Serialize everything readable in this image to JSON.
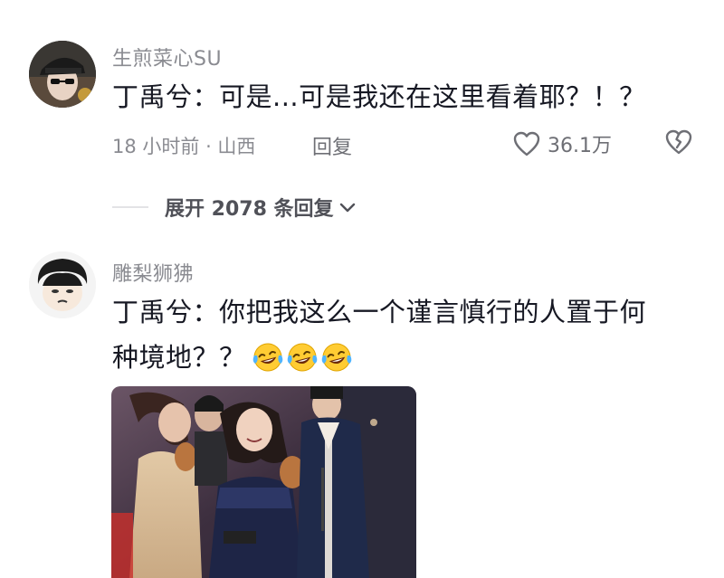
{
  "comment1": {
    "username": "生煎菜心SU",
    "text": "丁禹兮：可是...可是我还在这里看着耶？！？",
    "meta": "18 小时前 · 山西",
    "reply_label": "回复",
    "likes": "36.1万"
  },
  "expand": {
    "label": "展开 2078 条回复"
  },
  "comment2": {
    "username": "雕梨狮狒",
    "text_line1": "丁禹兮：你把我这么一个谨言慎行的人置于何",
    "text_line2": "种境地？？",
    "emojis": [
      "laugh-cry-emoji",
      "laugh-cry-emoji",
      "laugh-cry-emoji"
    ]
  },
  "colors": {
    "text_primary": "#161823",
    "text_secondary": "#8a8b91",
    "photo_background": "#4a3a4a"
  }
}
